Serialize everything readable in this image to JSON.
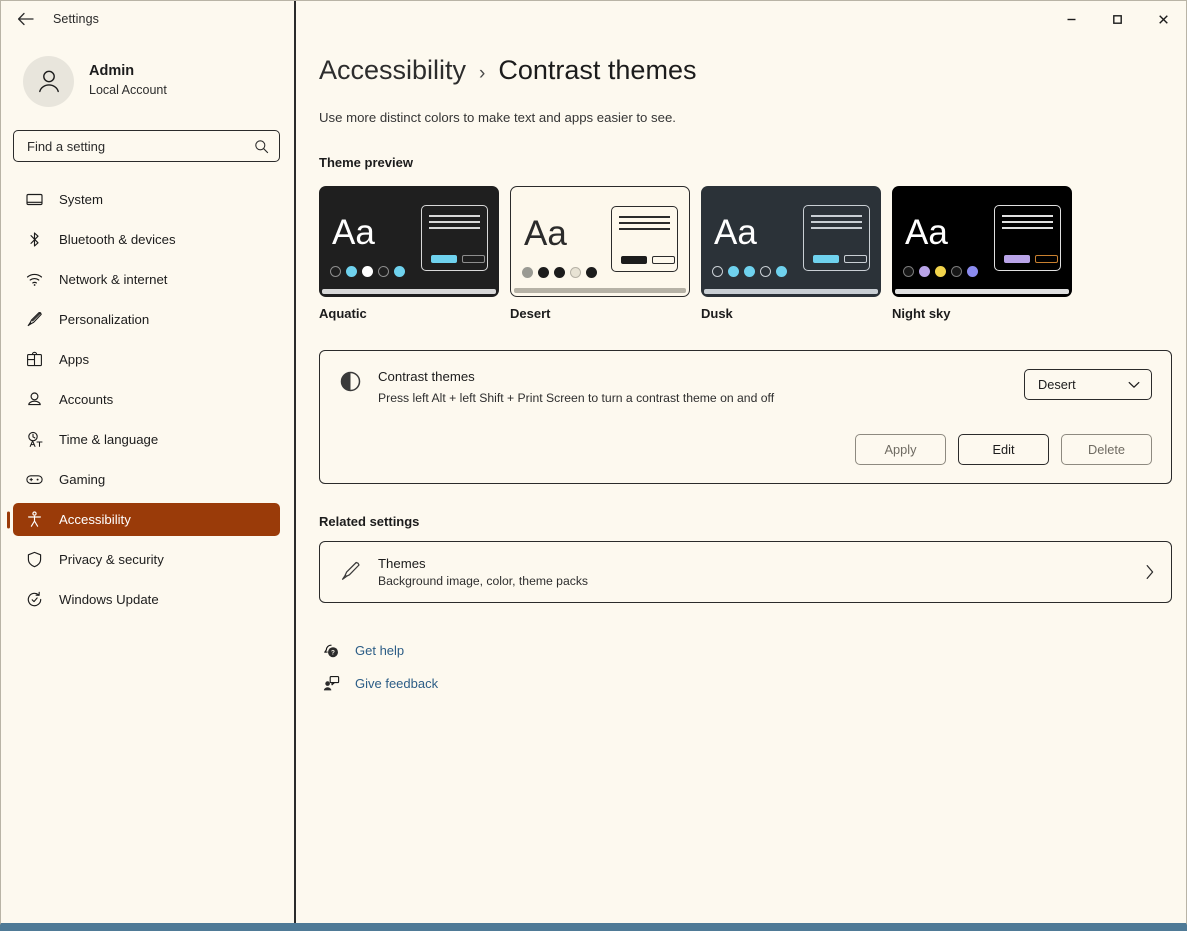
{
  "window": {
    "app_title": "Settings",
    "back_icon": "back-arrow-icon",
    "controls": {
      "minimize": "–",
      "maximize": "□",
      "close": "✕"
    }
  },
  "sidebar": {
    "account": {
      "name": "Admin",
      "subtitle": "Local Account",
      "avatar_icon": "person-avatar-icon"
    },
    "search": {
      "placeholder": "Find a setting",
      "icon": "search-icon"
    },
    "items": [
      {
        "label": "System",
        "icon": "system-icon",
        "active": false
      },
      {
        "label": "Bluetooth & devices",
        "icon": "bluetooth-icon",
        "active": false
      },
      {
        "label": "Network & internet",
        "icon": "wifi-icon",
        "active": false
      },
      {
        "label": "Personalization",
        "icon": "paintbrush-icon",
        "active": false
      },
      {
        "label": "Apps",
        "icon": "apps-grid-icon",
        "active": false
      },
      {
        "label": "Accounts",
        "icon": "account-person-icon",
        "active": false
      },
      {
        "label": "Time & language",
        "icon": "clock-language-icon",
        "active": false
      },
      {
        "label": "Gaming",
        "icon": "gamepad-icon",
        "active": false
      },
      {
        "label": "Accessibility",
        "icon": "accessibility-person-icon",
        "active": true
      },
      {
        "label": "Privacy & security",
        "icon": "shield-icon",
        "active": false
      },
      {
        "label": "Windows Update",
        "icon": "update-refresh-icon",
        "active": false
      }
    ],
    "accent_color": "#9A3B09",
    "background_color": "#FDF9EF"
  },
  "main": {
    "breadcrumb": {
      "parent": "Accessibility",
      "separator": "›",
      "current": "Contrast themes"
    },
    "subtitle": "Use more distinct colors to make text and apps easier to see.",
    "theme_preview_label": "Theme preview",
    "themes": [
      {
        "name": "Aquatic",
        "selected": false,
        "bg": "#1F1F1F",
        "text": "#FFFFFF",
        "dots": [
          "outline:#8e8e8e",
          "#6FD2EE",
          "#FFFFFF",
          "outline:#8e8e8e",
          "#6FD2EE"
        ],
        "mini_border": "#d8d8d8",
        "mini_line": "#d8d8d8",
        "btn_fill": "#6FD2EE",
        "btn_outline": "#8e8e8e",
        "bar": "#d8d8d8"
      },
      {
        "name": "Desert",
        "selected": true,
        "bg": "#FDF8EC",
        "text": "#2B2B2B",
        "dots": [
          "#9a9a93",
          "#1c1c1c",
          "#1c1c1c",
          "outline:#b6b2a6",
          "#1c1c1c"
        ],
        "mini_border": "#2b2b2b",
        "mini_line": "#2b2b2b",
        "btn_fill": "#1c1c1c",
        "btn_outline": "#2b2b2b",
        "bar": "#b6b2a6"
      },
      {
        "name": "Dusk",
        "selected": false,
        "bg": "#2B3238",
        "text": "#FFFFFF",
        "dots": [
          "outline:#c9cfd4",
          "#6FD2EE",
          "#6FD2EE",
          "outline:#c9cfd4",
          "#6FD2EE"
        ],
        "mini_border": "#c9cfd4",
        "mini_line": "#c9cfd4",
        "btn_fill": "#6FD2EE",
        "btn_outline": "#c9cfd4",
        "bar": "#c9cfd4"
      },
      {
        "name": "Night sky",
        "selected": false,
        "bg": "#000000",
        "text": "#FFFFFF",
        "dots": [
          "outline:#7a7a7a",
          "#B9A4E8",
          "#F2D44C",
          "outline:#7a7a7a",
          "#8C8CF0"
        ],
        "mini_border": "#e0e0e0",
        "mini_line": "#e0e0e0",
        "btn_fill": "#B9A4E8",
        "btn_outline": "#C9802F",
        "bar": "#e0e0e0"
      }
    ],
    "contrast_setting": {
      "icon": "contrast-circle-icon",
      "title": "Contrast themes",
      "description": "Press left Alt + left Shift + Print Screen to turn a contrast theme on and off",
      "dropdown": {
        "value": "Desert",
        "chevron_icon": "chevron-down-icon"
      },
      "buttons": [
        {
          "label": "Apply",
          "enabled": false
        },
        {
          "label": "Edit",
          "enabled": true
        },
        {
          "label": "Delete",
          "enabled": false
        }
      ]
    },
    "related_settings_label": "Related settings",
    "related_item": {
      "icon": "paintbrush-icon",
      "title": "Themes",
      "subtitle": "Background image, color, theme packs",
      "chevron_icon": "chevron-right-icon"
    },
    "links": [
      {
        "label": "Get help",
        "icon": "get-help-icon"
      },
      {
        "label": "Give feedback",
        "icon": "give-feedback-icon"
      }
    ],
    "link_color": "#2c5d86"
  }
}
